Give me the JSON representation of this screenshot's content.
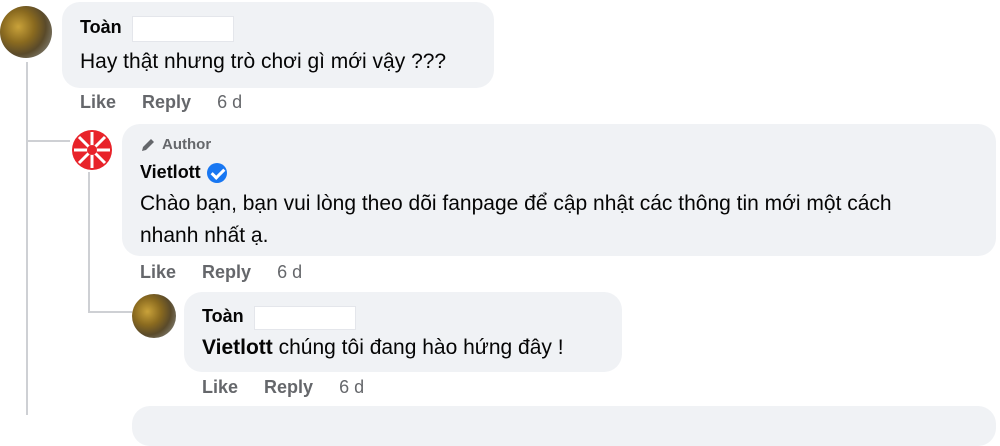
{
  "comment1": {
    "author": "Toàn",
    "text": "Hay thật nhưng trò chơi gì mới vậy ???",
    "like": "Like",
    "reply": "Reply",
    "time": "6 d"
  },
  "reply1": {
    "badge": "Author",
    "author": "Vietlott",
    "text_line1": "Chào bạn, bạn vui lòng theo dõi fanpage để cập nhật các thông tin mới một cách",
    "text_line2": "nhanh nhất ạ.",
    "like": "Like",
    "reply": "Reply",
    "time": "6 d"
  },
  "reply2": {
    "author": "Toàn",
    "mention": "Vietlott",
    "text": " chúng tôi đang hào hứng đây !",
    "like": "Like",
    "reply": "Reply",
    "time": "6 d"
  },
  "colors": {
    "bubble": "#f0f2f5",
    "secondary_text": "#65676b",
    "verified": "#1877f2",
    "brand_red": "#e8232a"
  }
}
